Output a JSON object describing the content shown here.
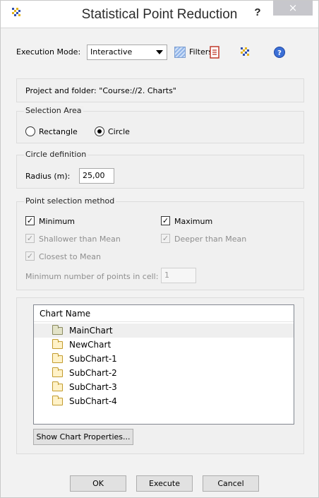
{
  "window": {
    "title": "Statistical Point Reduction",
    "help_label": "?",
    "close_label": "×"
  },
  "toolbar": {
    "exec_mode_label": "Execution Mode:",
    "exec_mode_value": "Interactive",
    "filters_label": "Filters"
  },
  "project": {
    "text": "Project and folder: \"Course://2. Charts\""
  },
  "selection_area": {
    "title": "Selection Area",
    "options": [
      "Rectangle",
      "Circle"
    ],
    "selected": "Circle"
  },
  "circle_definition": {
    "title": "Circle definition",
    "radius_label": "Radius (m):",
    "radius_value": "25,00"
  },
  "point_selection": {
    "title": "Point selection method",
    "minimum_label": "Minimum",
    "maximum_label": "Maximum",
    "shallower_label": "Shallower than Mean",
    "deeper_label": "Deeper than Mean",
    "closest_label": "Closest to Mean",
    "min_points_label": "Minimum number of points in cell:",
    "min_points_value": "1"
  },
  "charts": {
    "header": "Chart Name",
    "items": [
      "MainChart",
      "NewChart",
      "SubChart-1",
      "SubChart-2",
      "SubChart-3",
      "SubChart-4"
    ],
    "show_properties_label": "Show Chart Properties..."
  },
  "footer": {
    "ok_label": "OK",
    "execute_label": "Execute",
    "cancel_label": "Cancel"
  },
  "colors": {
    "background": "#f0f0f0",
    "close_button": "#c7c7cc",
    "folder_fill": "#fff2c8",
    "folder_border": "#c29b2d"
  }
}
